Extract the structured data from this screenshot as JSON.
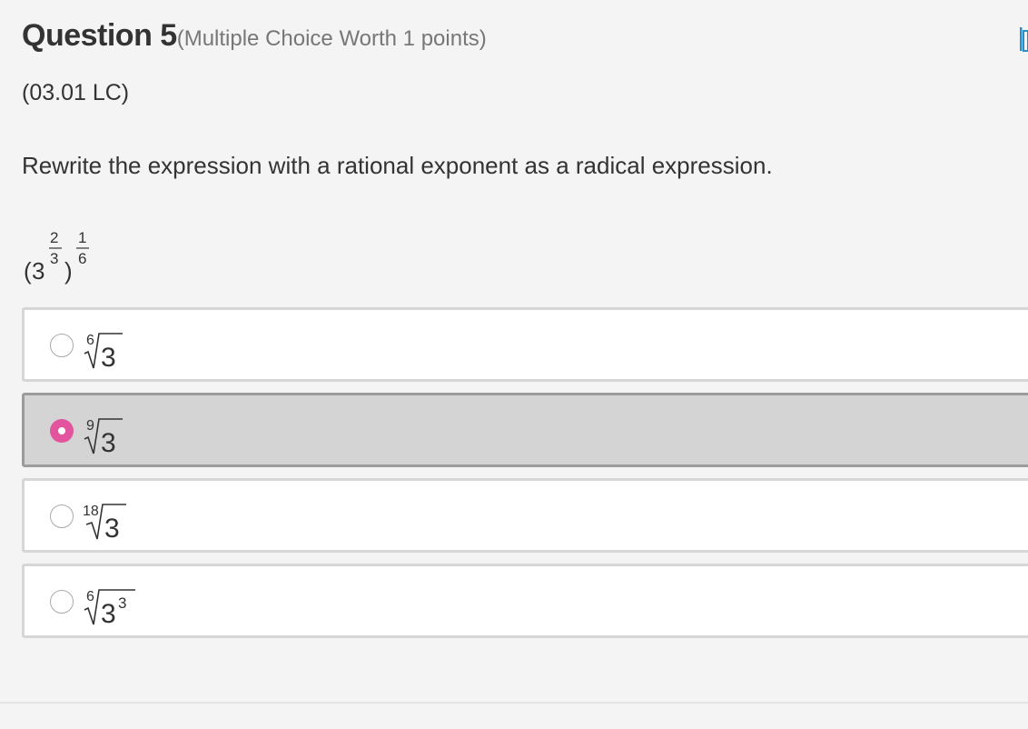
{
  "question": {
    "title": "Question 5",
    "meta": "(Multiple Choice Worth 1 points)",
    "code": "(03.01 LC)",
    "prompt": "Rewrite the expression with a rational exponent as a radical expression.",
    "expression": {
      "base": "3",
      "inner_exponent_num": "2",
      "inner_exponent_den": "3",
      "outer_exponent_num": "1",
      "outer_exponent_den": "6"
    }
  },
  "options": [
    {
      "index": "6",
      "radicand": "3",
      "radicand_exponent": "",
      "selected": false
    },
    {
      "index": "9",
      "radicand": "3",
      "radicand_exponent": "",
      "selected": true
    },
    {
      "index": "18",
      "radicand": "3",
      "radicand_exponent": "",
      "selected": false
    },
    {
      "index": "6",
      "radicand": "3",
      "radicand_exponent": "3",
      "selected": false
    }
  ],
  "colors": {
    "selected_radio": "#e2559e",
    "selected_background": "#d4d4d4",
    "edge_icon": "#2a8fc7"
  },
  "icons": {
    "edge": "bookmark-icon"
  }
}
